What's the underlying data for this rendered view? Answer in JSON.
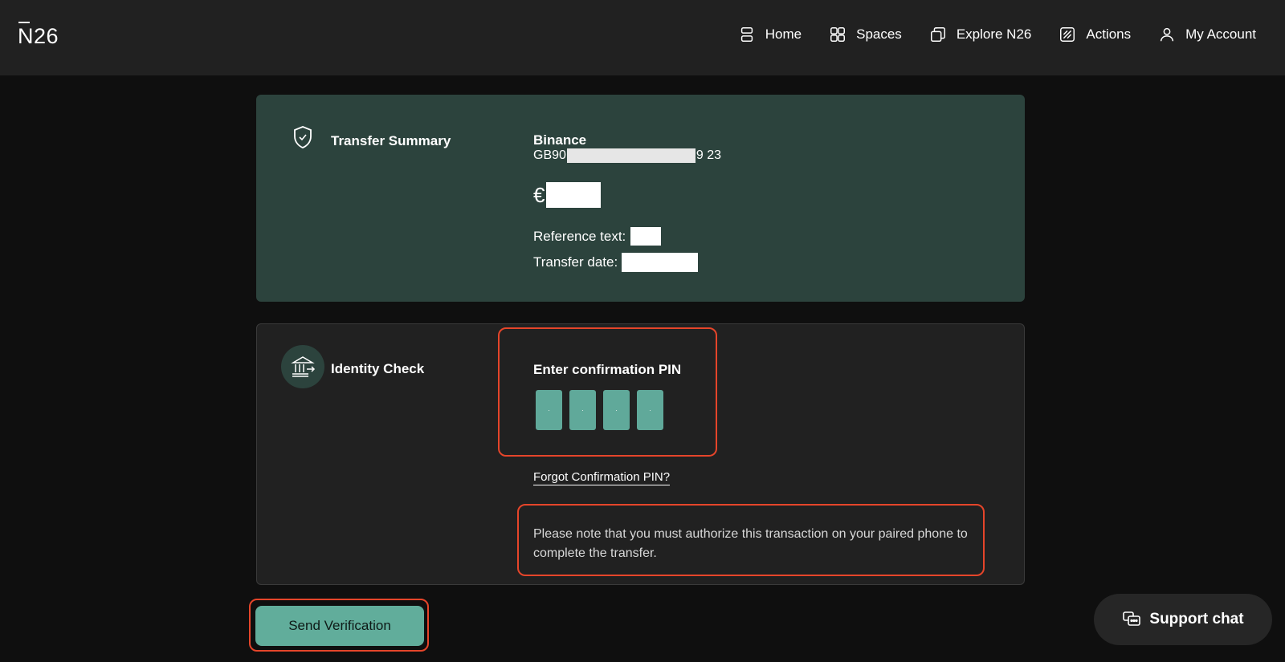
{
  "header": {
    "logo": "N26",
    "nav": [
      {
        "label": "Home",
        "icon": "home-icon"
      },
      {
        "label": "Spaces",
        "icon": "spaces-icon"
      },
      {
        "label": "Explore N26",
        "icon": "explore-icon"
      },
      {
        "label": "Actions",
        "icon": "actions-icon"
      },
      {
        "label": "My Account",
        "icon": "account-icon"
      }
    ]
  },
  "summary": {
    "title": "Transfer Summary",
    "recipient": "Binance",
    "iban_prefix": "GB90",
    "iban_suffix": "9 23",
    "currency": "€",
    "reference_label": "Reference text:",
    "date_label": "Transfer date:"
  },
  "identity": {
    "title": "Identity Check",
    "pin_label": "Enter confirmation PIN",
    "pin_digits": [
      "·",
      "·",
      "·",
      "·"
    ],
    "forgot_link": "Forgot Confirmation PIN?",
    "note": "Please note that you must authorize this transaction on your paired phone to complete the transfer."
  },
  "actions": {
    "send_label": "Send Verification",
    "support_label": "Support chat"
  },
  "colors": {
    "accent": "#61ad9b",
    "summary_bg": "#2c433d",
    "highlight": "#e5452a"
  }
}
